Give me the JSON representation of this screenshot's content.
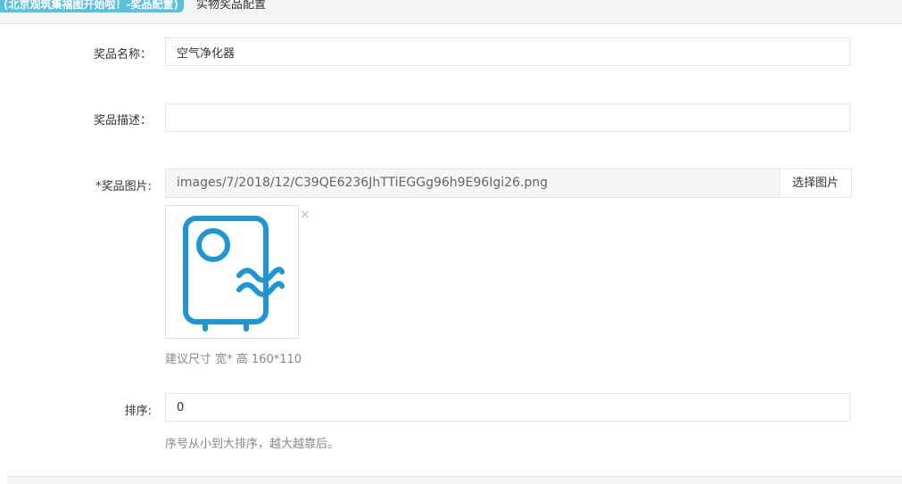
{
  "header": {
    "badge": "(北京观筑集福图开始啦！-奖品配置)",
    "page_title": "实物奖品配置"
  },
  "form": {
    "name": {
      "label": "奖品名称：",
      "value": "空气净化器"
    },
    "description": {
      "label": "奖品描述：",
      "value": ""
    },
    "image": {
      "label": "*奖品图片:",
      "path": "images/7/2018/12/C39QE6236JhTTiEGGg96h9E96Igi26.png",
      "choose_button": "选择图片",
      "remove_icon": "×",
      "preview_icon": "air-purifier-icon",
      "hint": "建议尺寸 宽* 高 160*110"
    },
    "order": {
      "label": "排序:",
      "value": "0",
      "hint": "序号从小到大排序，越大越靠后。"
    }
  },
  "colors": {
    "accent": "#5bc0de",
    "icon": "#1e96d6"
  }
}
